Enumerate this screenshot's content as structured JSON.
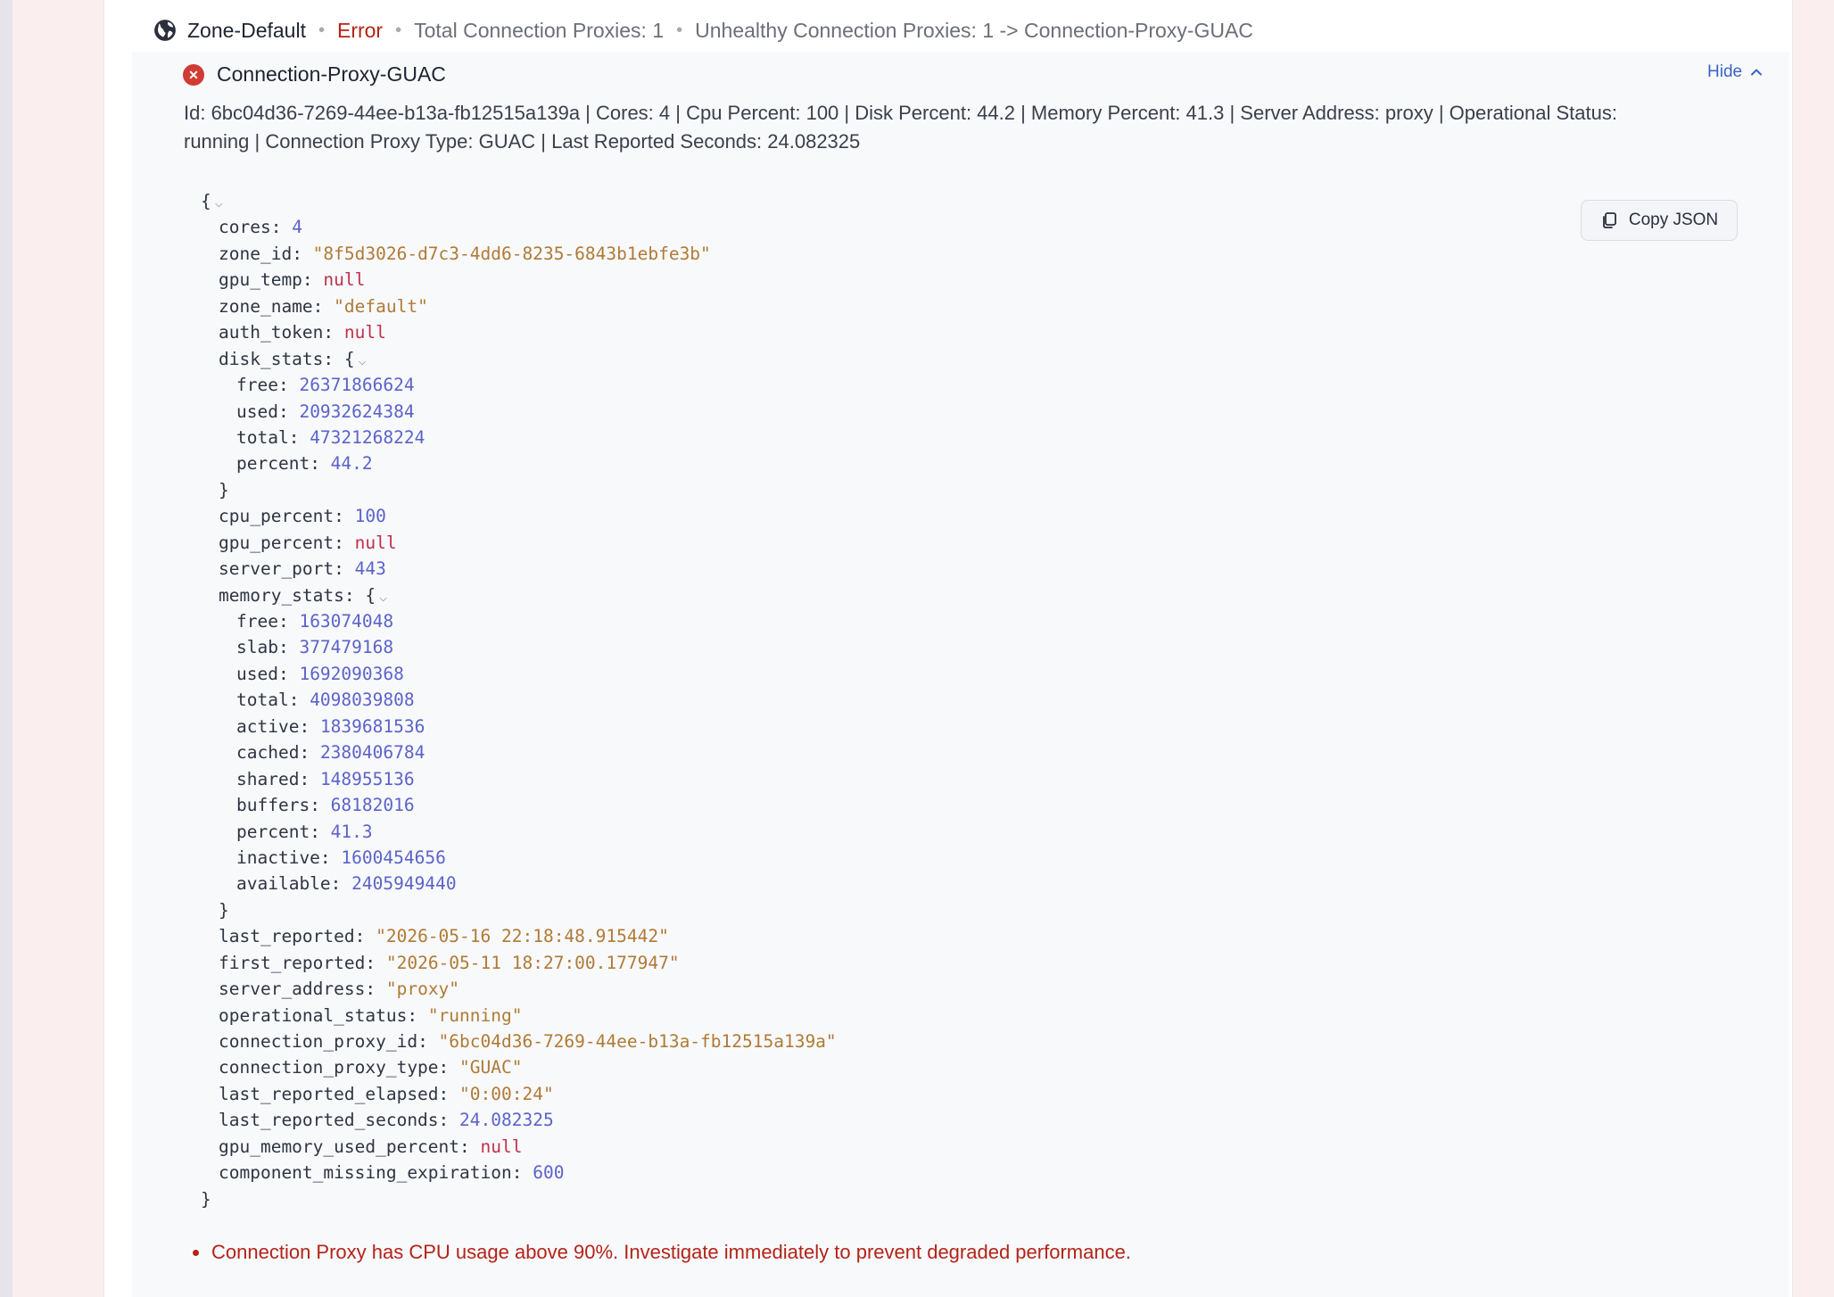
{
  "zone": {
    "name": "Zone-Default",
    "status": "Error",
    "sep": "•",
    "total_proxies": "Total Connection Proxies: 1",
    "unhealthy_proxies": "Unhealthy Connection Proxies: 1",
    "arrow_target": " -> Connection-Proxy-GUAC",
    "icon": "globe-icon"
  },
  "proxy": {
    "title": "Connection-Proxy-GUAC",
    "status_icon": "error-x-icon",
    "status_color": "#d13b33",
    "hide_label": "Hide",
    "summary": "Id: 6bc04d36-7269-44ee-b13a-fb12515a139a | Cores: 4 | Cpu Percent: 100 | Disk Percent: 44.2 | Memory Percent: 41.3 | Server Address: proxy | Operational Status: running | Connection Proxy Type: GUAC | Last Reported Seconds: 24.082325",
    "copy_label": "Copy JSON"
  },
  "json_lines": [
    {
      "indent": 0,
      "key": null,
      "text": "{",
      "type": "punct",
      "collapsible": true
    },
    {
      "indent": 1,
      "key": "cores",
      "val": "4",
      "type": "n"
    },
    {
      "indent": 1,
      "key": "zone_id",
      "val": "\"8f5d3026-d7c3-4dd6-8235-6843b1ebfe3b\"",
      "type": "s"
    },
    {
      "indent": 1,
      "key": "gpu_temp",
      "val": "null",
      "type": "nl"
    },
    {
      "indent": 1,
      "key": "zone_name",
      "val": "\"default\"",
      "type": "s"
    },
    {
      "indent": 1,
      "key": "auth_token",
      "val": "null",
      "type": "nl"
    },
    {
      "indent": 1,
      "key": "disk_stats",
      "val": "{",
      "type": "punct",
      "collapsible": true
    },
    {
      "indent": 2,
      "key": "free",
      "val": "26371866624",
      "type": "n"
    },
    {
      "indent": 2,
      "key": "used",
      "val": "20932624384",
      "type": "n"
    },
    {
      "indent": 2,
      "key": "total",
      "val": "47321268224",
      "type": "n"
    },
    {
      "indent": 2,
      "key": "percent",
      "val": "44.2",
      "type": "n"
    },
    {
      "indent": 1,
      "key": null,
      "text": "}",
      "type": "punct"
    },
    {
      "indent": 1,
      "key": "cpu_percent",
      "val": "100",
      "type": "n"
    },
    {
      "indent": 1,
      "key": "gpu_percent",
      "val": "null",
      "type": "nl"
    },
    {
      "indent": 1,
      "key": "server_port",
      "val": "443",
      "type": "n"
    },
    {
      "indent": 1,
      "key": "memory_stats",
      "val": "{",
      "type": "punct",
      "collapsible": true
    },
    {
      "indent": 2,
      "key": "free",
      "val": "163074048",
      "type": "n"
    },
    {
      "indent": 2,
      "key": "slab",
      "val": "377479168",
      "type": "n"
    },
    {
      "indent": 2,
      "key": "used",
      "val": "1692090368",
      "type": "n"
    },
    {
      "indent": 2,
      "key": "total",
      "val": "4098039808",
      "type": "n"
    },
    {
      "indent": 2,
      "key": "active",
      "val": "1839681536",
      "type": "n"
    },
    {
      "indent": 2,
      "key": "cached",
      "val": "2380406784",
      "type": "n"
    },
    {
      "indent": 2,
      "key": "shared",
      "val": "148955136",
      "type": "n"
    },
    {
      "indent": 2,
      "key": "buffers",
      "val": "68182016",
      "type": "n"
    },
    {
      "indent": 2,
      "key": "percent",
      "val": "41.3",
      "type": "n"
    },
    {
      "indent": 2,
      "key": "inactive",
      "val": "1600454656",
      "type": "n"
    },
    {
      "indent": 2,
      "key": "available",
      "val": "2405949440",
      "type": "n"
    },
    {
      "indent": 1,
      "key": null,
      "text": "}",
      "type": "punct"
    },
    {
      "indent": 1,
      "key": "last_reported",
      "val": "\"2026-05-16 22:18:48.915442\"",
      "type": "s"
    },
    {
      "indent": 1,
      "key": "first_reported",
      "val": "\"2026-05-11 18:27:00.177947\"",
      "type": "s"
    },
    {
      "indent": 1,
      "key": "server_address",
      "val": "\"proxy\"",
      "type": "s"
    },
    {
      "indent": 1,
      "key": "operational_status",
      "val": "\"running\"",
      "type": "s"
    },
    {
      "indent": 1,
      "key": "connection_proxy_id",
      "val": "\"6bc04d36-7269-44ee-b13a-fb12515a139a\"",
      "type": "s"
    },
    {
      "indent": 1,
      "key": "connection_proxy_type",
      "val": "\"GUAC\"",
      "type": "s"
    },
    {
      "indent": 1,
      "key": "last_reported_elapsed",
      "val": "\"0:00:24\"",
      "type": "s"
    },
    {
      "indent": 1,
      "key": "last_reported_seconds",
      "val": "24.082325",
      "type": "n"
    },
    {
      "indent": 1,
      "key": "gpu_memory_used_percent",
      "val": "null",
      "type": "nl"
    },
    {
      "indent": 1,
      "key": "component_missing_expiration",
      "val": "600",
      "type": "n"
    },
    {
      "indent": 0,
      "key": null,
      "text": "}",
      "type": "punct"
    }
  ],
  "alerts": [
    "Connection Proxy has CPU usage above 90%. Investigate immediately to prevent degraded performance."
  ],
  "colors": {
    "error": "#b42318",
    "string": "#b07a36",
    "number": "#5b63c9",
    "null": "#c0304a",
    "link": "#3b62c8"
  }
}
